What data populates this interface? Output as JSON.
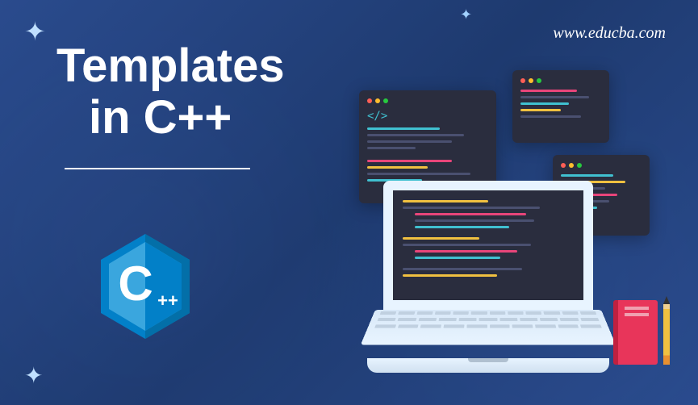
{
  "title": {
    "line1": "Templates",
    "line2": "in C++"
  },
  "url": "www.educba.com",
  "logo": {
    "letter": "C",
    "suffix": "++"
  },
  "colors": {
    "background": "#2a4b8d",
    "logo_hex": "#0280c8",
    "accent_pink": "#e8457a",
    "accent_yellow": "#f0c040",
    "accent_cyan": "#40c0d0",
    "notebook": "#e8355a"
  }
}
